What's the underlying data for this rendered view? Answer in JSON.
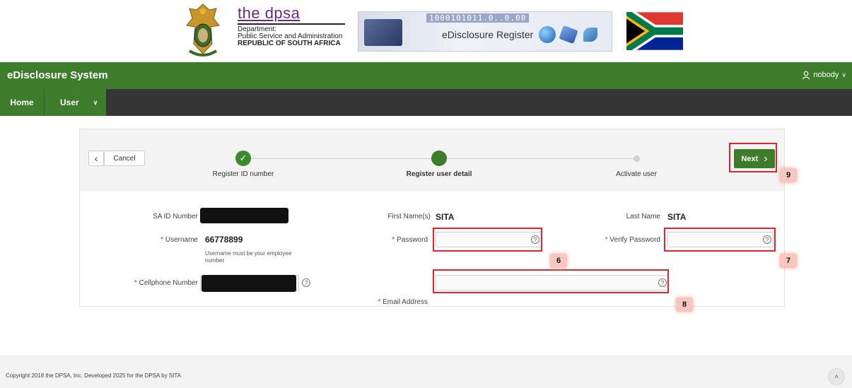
{
  "banner": {
    "dpsa_title": "the dpsa",
    "dpsa_line1": "Department:",
    "dpsa_line2": "Public Service and Administration",
    "dpsa_line3": "REPUBLIC OF SOUTH AFRICA",
    "edisclosure_binary": "1000101011.0..0.00",
    "edisclosure_title": "eDisclosure Register"
  },
  "header": {
    "app_title": "eDisclosure System",
    "user_name": "nobody",
    "user_icon": "user-icon",
    "chevron": "∨"
  },
  "nav": {
    "home_label": "Home",
    "user_label": "User",
    "user_chevron": "∨"
  },
  "wizard": {
    "back_icon": "‹",
    "cancel_label": "Cancel",
    "next_label": "Next",
    "next_icon": "›",
    "steps": [
      {
        "label": "Register ID number",
        "state": "done"
      },
      {
        "label": "Register user detail",
        "state": "current"
      },
      {
        "label": "Activate user",
        "state": "future"
      }
    ],
    "done_icon": "✓"
  },
  "form": {
    "sa_id_label": "SA ID Number",
    "username_label": "Username",
    "username_value": "66778899",
    "username_help": "Username must be your employee number",
    "cellphone_label": "Cellphone Number",
    "first_name_label": "First Name(s)",
    "first_name_value": "SITA",
    "last_name_label": "Last Name",
    "last_name_value": "SITA",
    "password_label": "Password",
    "password_value": "",
    "verify_password_label": "Verify Password",
    "verify_password_value": "",
    "email_label": "Email Address",
    "email_value": "",
    "required_mark": "*",
    "help_glyph": "?"
  },
  "annotations": {
    "password": "6",
    "verify_password": "7",
    "email": "8",
    "next": "9"
  },
  "footer": {
    "copyright": "Copyright 2018 the DPSA, Inc. Developed 2025 for the DPSA by SITA",
    "scroll_top_icon": "˄"
  },
  "colors": {
    "primary_green": "#3c7c2a",
    "nav_dark": "#353535",
    "highlight_red": "#e0252d"
  }
}
